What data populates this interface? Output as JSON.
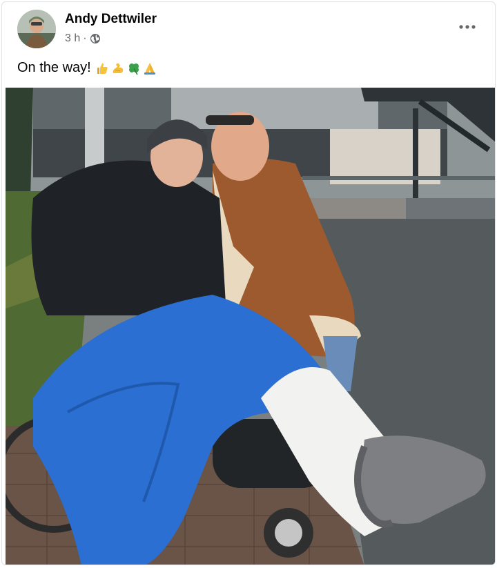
{
  "post": {
    "author_name": "Andy Dettwiler",
    "timestamp": "3 h",
    "separator": "·",
    "audience_icon": "globe-icon",
    "more_icon": "more-options-icon",
    "caption_text": "On the way!",
    "caption_emojis": [
      "thumbs-up-emoji",
      "flexed-biceps-emoji",
      "four-leaf-clover-emoji",
      "folded-hands-emoji"
    ]
  },
  "colors": {
    "text_primary": "#050505",
    "text_secondary": "#65676b",
    "card_border": "#dfe1e5"
  }
}
